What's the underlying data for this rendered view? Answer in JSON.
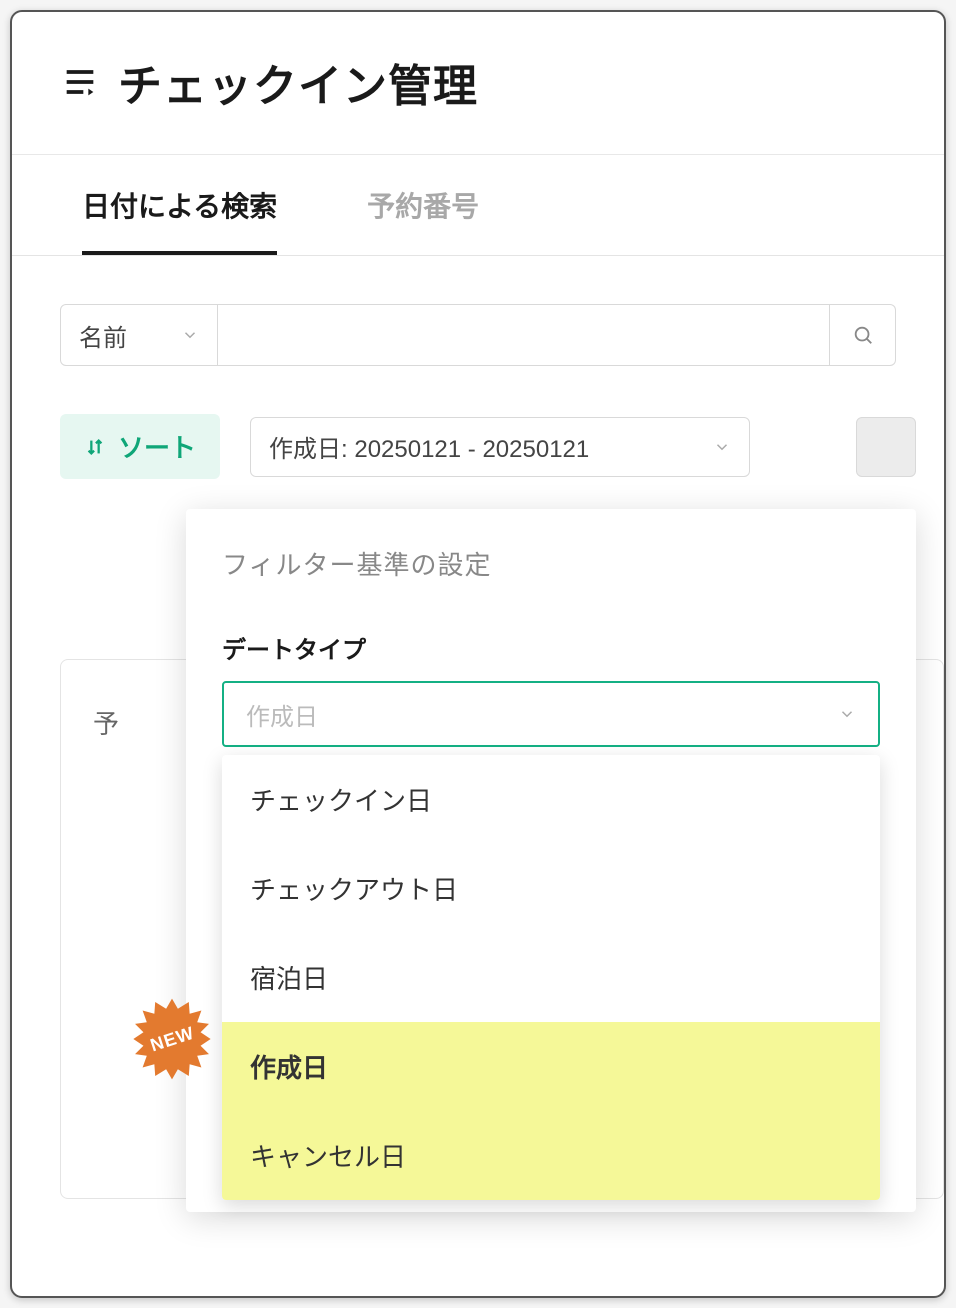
{
  "header": {
    "title": "チェックイン管理"
  },
  "tabs": {
    "date_search": "日付による検索",
    "reservation_no": "予約番号"
  },
  "search": {
    "field_selected": "名前"
  },
  "toolbar": {
    "sort_label": "ソート",
    "date_filter_label": "作成日: 20250121 - 20250121"
  },
  "card": {
    "col_reservation_prefix": "予"
  },
  "filter_panel": {
    "title": "フィルター基準の設定",
    "section_label": "デートタイプ",
    "selected_placeholder": "作成日",
    "options": {
      "checkin": "チェックイン日",
      "checkout": "チェックアウト日",
      "stay": "宿泊日",
      "created": "作成日",
      "cancel": "キャンセル日"
    }
  },
  "badge": {
    "new_label": "NEW"
  }
}
